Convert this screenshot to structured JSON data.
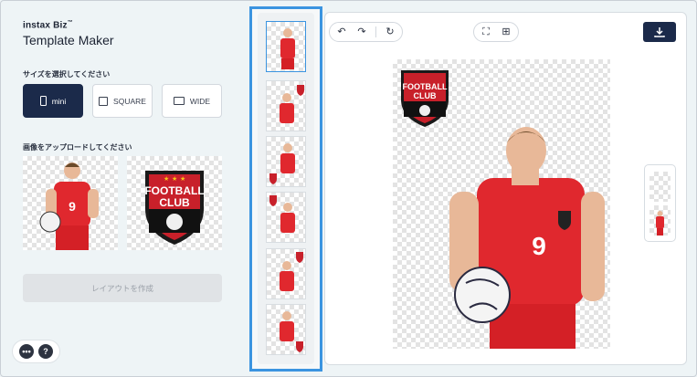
{
  "brand": {
    "name": "instax Biz",
    "trademark": "™",
    "subtitle": "Template Maker"
  },
  "size_section": {
    "label": "サイズを選択してください",
    "options": [
      {
        "label": "mini",
        "icon": "phone-portrait-icon",
        "selected": true
      },
      {
        "label": "SQUARE",
        "icon": "square-icon",
        "selected": false
      },
      {
        "label": "WIDE",
        "icon": "landscape-icon",
        "selected": false
      }
    ]
  },
  "upload_section": {
    "label": "画像をアップロードしてください"
  },
  "uploaded_images": [
    {
      "name": "player-photo"
    },
    {
      "name": "football-club-logo",
      "logo_text_line1": "FOOTBALL",
      "logo_text_line2": "CLUB"
    }
  ],
  "create_button": {
    "label": "レイアウトを作成",
    "enabled": false
  },
  "footer": {
    "more_icon": "more-icon",
    "help_label": "?"
  },
  "toolbar": {
    "undo_icon": "undo-icon",
    "redo_icon": "redo-icon",
    "reset_icon": "reset-icon",
    "frame_icon": "frame-icon",
    "add_icon": "add-icon",
    "download_icon": "download-icon"
  },
  "layouts_count": 6,
  "player": {
    "jersey_number": "9"
  },
  "colors": {
    "navy": "#1b2a4a",
    "accent_blue": "#3b94e0",
    "jersey_red": "#e0282e"
  }
}
